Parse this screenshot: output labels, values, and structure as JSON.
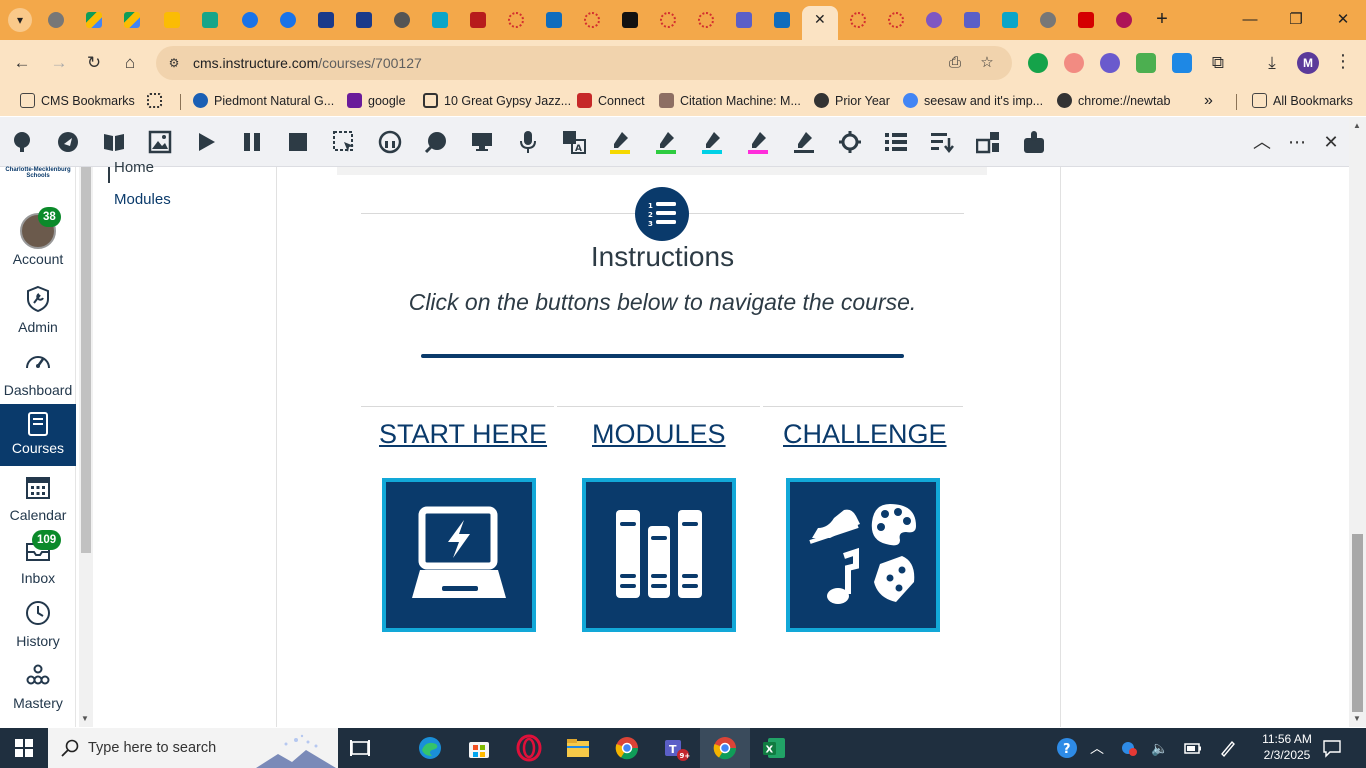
{
  "browser": {
    "url_host": "cms.instructure.com",
    "url_path": "/courses/700127",
    "profile_initial": "M",
    "bookmarks": [
      {
        "label": "CMS Bookmarks",
        "color": "#4a4a4a"
      },
      {
        "label": "Piedmont Natural G...",
        "color": "#1a5fb4"
      },
      {
        "label": "google",
        "color": "#6a1b9a"
      },
      {
        "label": "10 Great Gypsy Jazz...",
        "color": "#333333"
      },
      {
        "label": "Connect",
        "color": "#c62828"
      },
      {
        "label": "Citation Machine: M...",
        "color": "#8d6e63"
      },
      {
        "label": "Prior Year",
        "color": "#333333"
      },
      {
        "label": "seesaw and it's imp...",
        "color": "#4285f4"
      },
      {
        "label": "chrome://newtab",
        "color": "#333333"
      }
    ],
    "all_bookmarks": "All Bookmarks"
  },
  "global_nav": {
    "logo_text": "Charlotte-Mecklenburg Schools",
    "items": [
      {
        "label": "Account",
        "badge": "38"
      },
      {
        "label": "Admin",
        "badge": ""
      },
      {
        "label": "Dashboard",
        "badge": ""
      },
      {
        "label": "Courses",
        "badge": ""
      },
      {
        "label": "Calendar",
        "badge": ""
      },
      {
        "label": "Inbox",
        "badge": "109"
      },
      {
        "label": "History",
        "badge": ""
      },
      {
        "label": "Mastery",
        "badge": ""
      }
    ]
  },
  "course_nav": {
    "home": "Home",
    "modules": "Modules"
  },
  "content": {
    "title": "Instructions",
    "subtitle": "Click on the buttons below to navigate the course.",
    "buttons": [
      {
        "label": "START HERE",
        "icon": "laptop-lightning-icon"
      },
      {
        "label": "MODULES",
        "icon": "books-icon"
      },
      {
        "label": "CHALLENGE",
        "icon": "hobbies-icon"
      }
    ],
    "accent": "#0a3a6b",
    "tile_border": "#12a8d8"
  },
  "taskbar": {
    "search_placeholder": "Type here to search",
    "time": "11:56 AM",
    "date": "2/3/2025"
  }
}
